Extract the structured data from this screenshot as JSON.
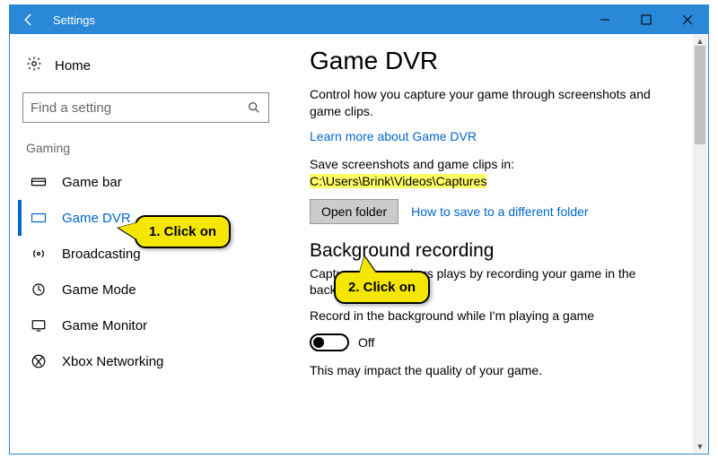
{
  "titlebar": {
    "title": "Settings"
  },
  "sidebar": {
    "home": "Home",
    "search_placeholder": "Find a setting",
    "category": "Gaming",
    "items": [
      {
        "label": "Game bar"
      },
      {
        "label": "Game DVR"
      },
      {
        "label": "Broadcasting"
      },
      {
        "label": "Game Mode"
      },
      {
        "label": "Game Monitor"
      },
      {
        "label": "Xbox Networking"
      }
    ]
  },
  "content": {
    "heading": "Game DVR",
    "intro": "Control how you capture your game through screenshots and game clips.",
    "learn_link": "Learn more about Game DVR",
    "save_label": "Save screenshots and game clips in: ",
    "save_path": "C:\\Users\\Brink\\Videos\\Captures",
    "open_folder": "Open folder",
    "howto_link": "How to save to a different folder",
    "bg_heading": "Background recording",
    "bg_desc": "Capture your previous plays by recording your game in the background.",
    "bg_toggle_label": "Record in the background while I'm playing a game",
    "toggle_state": "Off",
    "impact": "This may impact the quality of your game."
  },
  "callouts": {
    "one": "1. Click on",
    "two": "2. Click on"
  }
}
